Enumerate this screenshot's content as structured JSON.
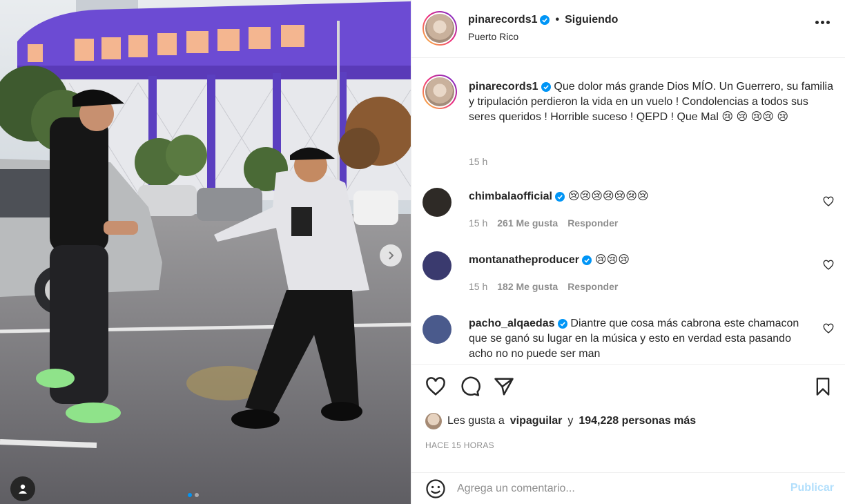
{
  "post": {
    "username": "pinarecords1",
    "follow_status": "Siguiendo",
    "location": "Puerto Rico",
    "caption_text": "Que dolor más grande Dios MÍO. Un Guerrero, su familia y tripulación perdieron la vida en un vuelo ! Condolencias a todos sus seres queridos ! Horrible suceso ! QEPD ! Que Mal 😢 😢 😢😢 😢",
    "caption_time": "15 h"
  },
  "comments": [
    {
      "username": "chimbalaofficial",
      "text": "😢😢😢😢😢😢😢",
      "time": "15 h",
      "likes": "261 Me gusta",
      "reply": "Responder",
      "avatar_color": "#2e2a26"
    },
    {
      "username": "montanatheproducer",
      "text": "😢😢😢",
      "time": "15 h",
      "likes": "182 Me gusta",
      "reply": "Responder",
      "avatar_color": "#3a3a6e"
    },
    {
      "username": "pacho_alqaedas",
      "text": "Diantre que cosa más cabrona este chamacon que se ganó su lugar en la música y esto en verdad esta pasando acho no no puede ser man",
      "avatar_color": "#4a5a8c"
    }
  ],
  "likes_section": {
    "prefix": "Les gusta a",
    "user": "vipaguilar",
    "middle": "y",
    "count": "194,228 personas más",
    "when": "HACE 15 HORAS"
  },
  "comment_box": {
    "placeholder": "Agrega un comentario...",
    "publish_label": "Publicar"
  },
  "icons": {
    "verified": "verified-badge-icon",
    "more": "more-options-icon",
    "like": "heart-icon",
    "comment": "comment-icon",
    "share": "share-icon",
    "save": "bookmark-icon",
    "emoji": "emoji-icon",
    "next": "chevron-right-icon",
    "tag": "user-tag-icon"
  },
  "colors": {
    "verified": "#0095f6",
    "publish_disabled": "#b2dffc",
    "secondary_text": "#8e8e8e"
  }
}
